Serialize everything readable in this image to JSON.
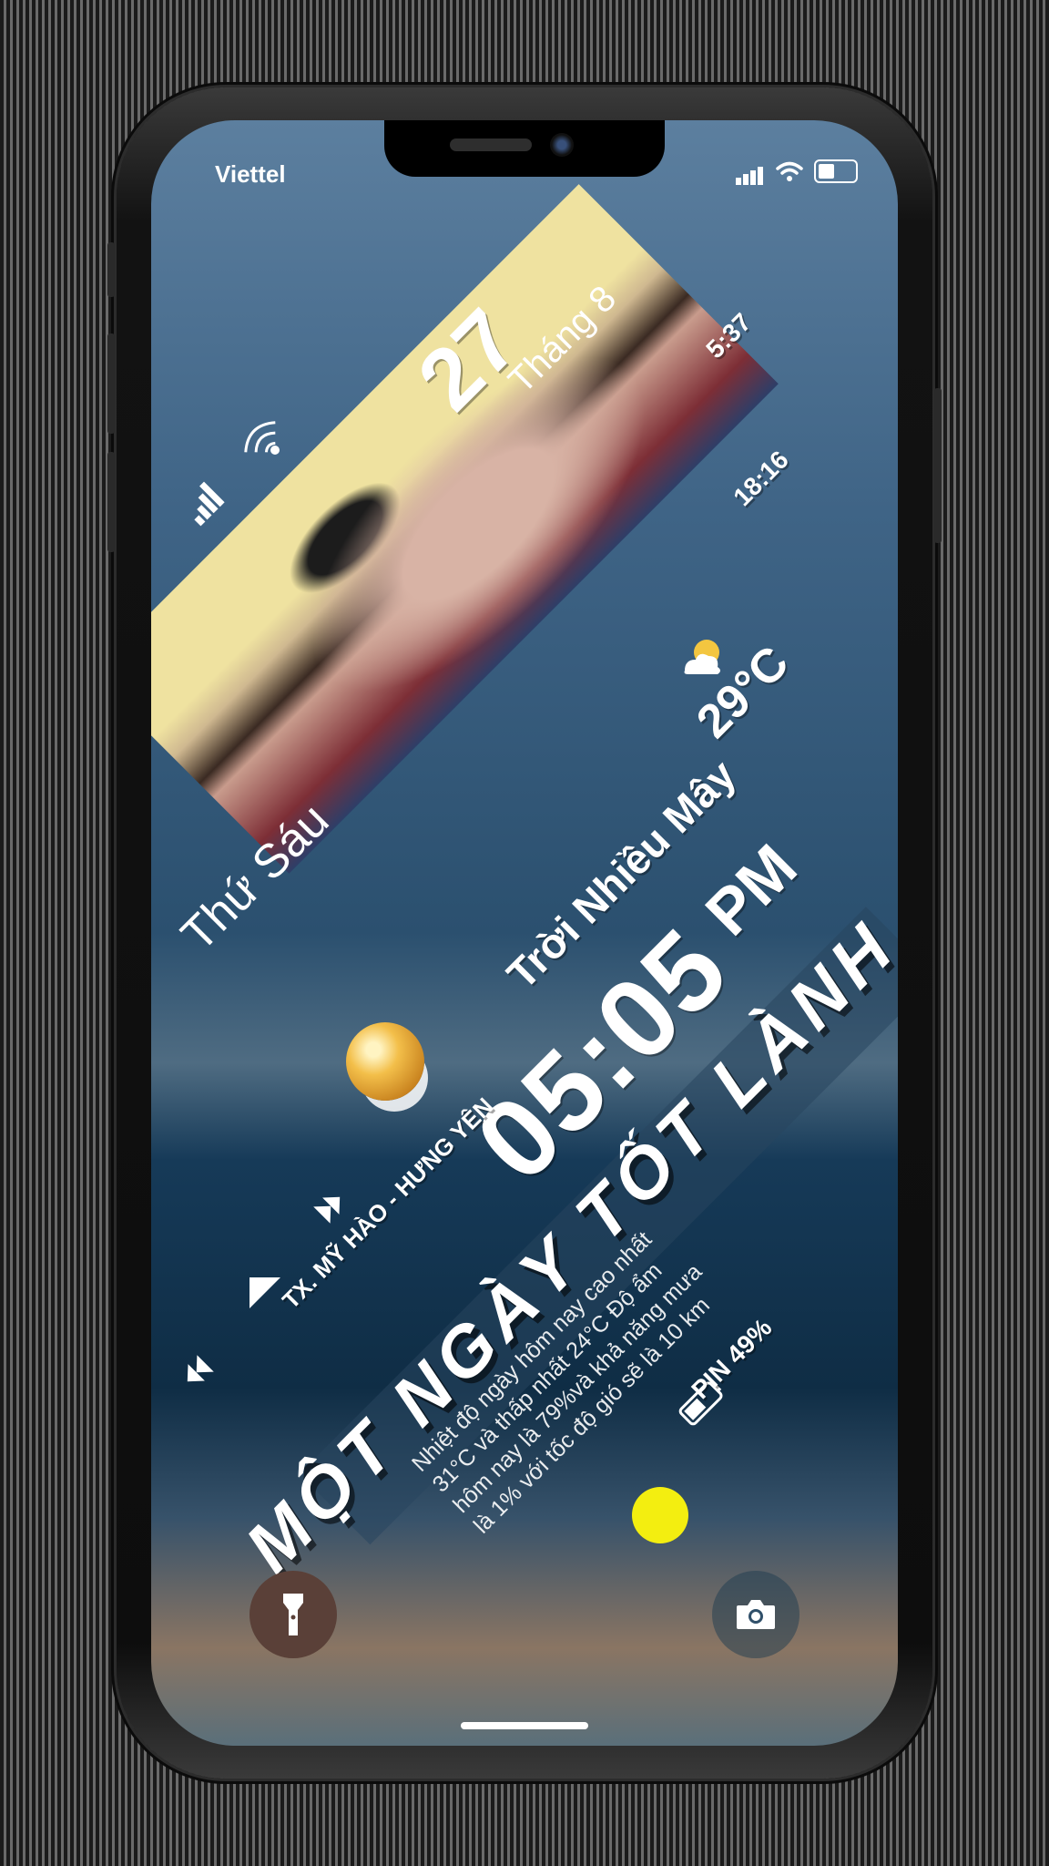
{
  "status_bar": {
    "carrier": "Viettel",
    "battery_level": 0.45
  },
  "widgets": {
    "day": "27",
    "month": "Tháng 8",
    "sunrise": "5:37",
    "sunset": "18:16",
    "temperature": "29°C",
    "weekday": "Thứ Sáu",
    "condition": "Trời Nhiều Mây",
    "time": "05:05",
    "ampm": "PM",
    "greeting": "MỘT NGÀY TỐT LÀNH",
    "location": "TX. MỸ HÀO - HƯNG YÊN",
    "forecast_lines": [
      "Nhiệt độ ngày hôm nay cao nhất",
      "31°C và thấp nhất 24°C Độ ẩm",
      "hôm nay là 79%và khả năng mưa",
      "là 1% với tốc độ gió sẽ là 10 km"
    ],
    "battery_label": "PIN 49%"
  },
  "icons": {
    "flashlight": "flashlight-icon",
    "camera": "camera-icon",
    "wifi": "wifi-icon",
    "signal": "cellular-signal-icon"
  },
  "colors": {
    "accent_yellow": "#f3ee10",
    "band_blue": "#12375a"
  }
}
